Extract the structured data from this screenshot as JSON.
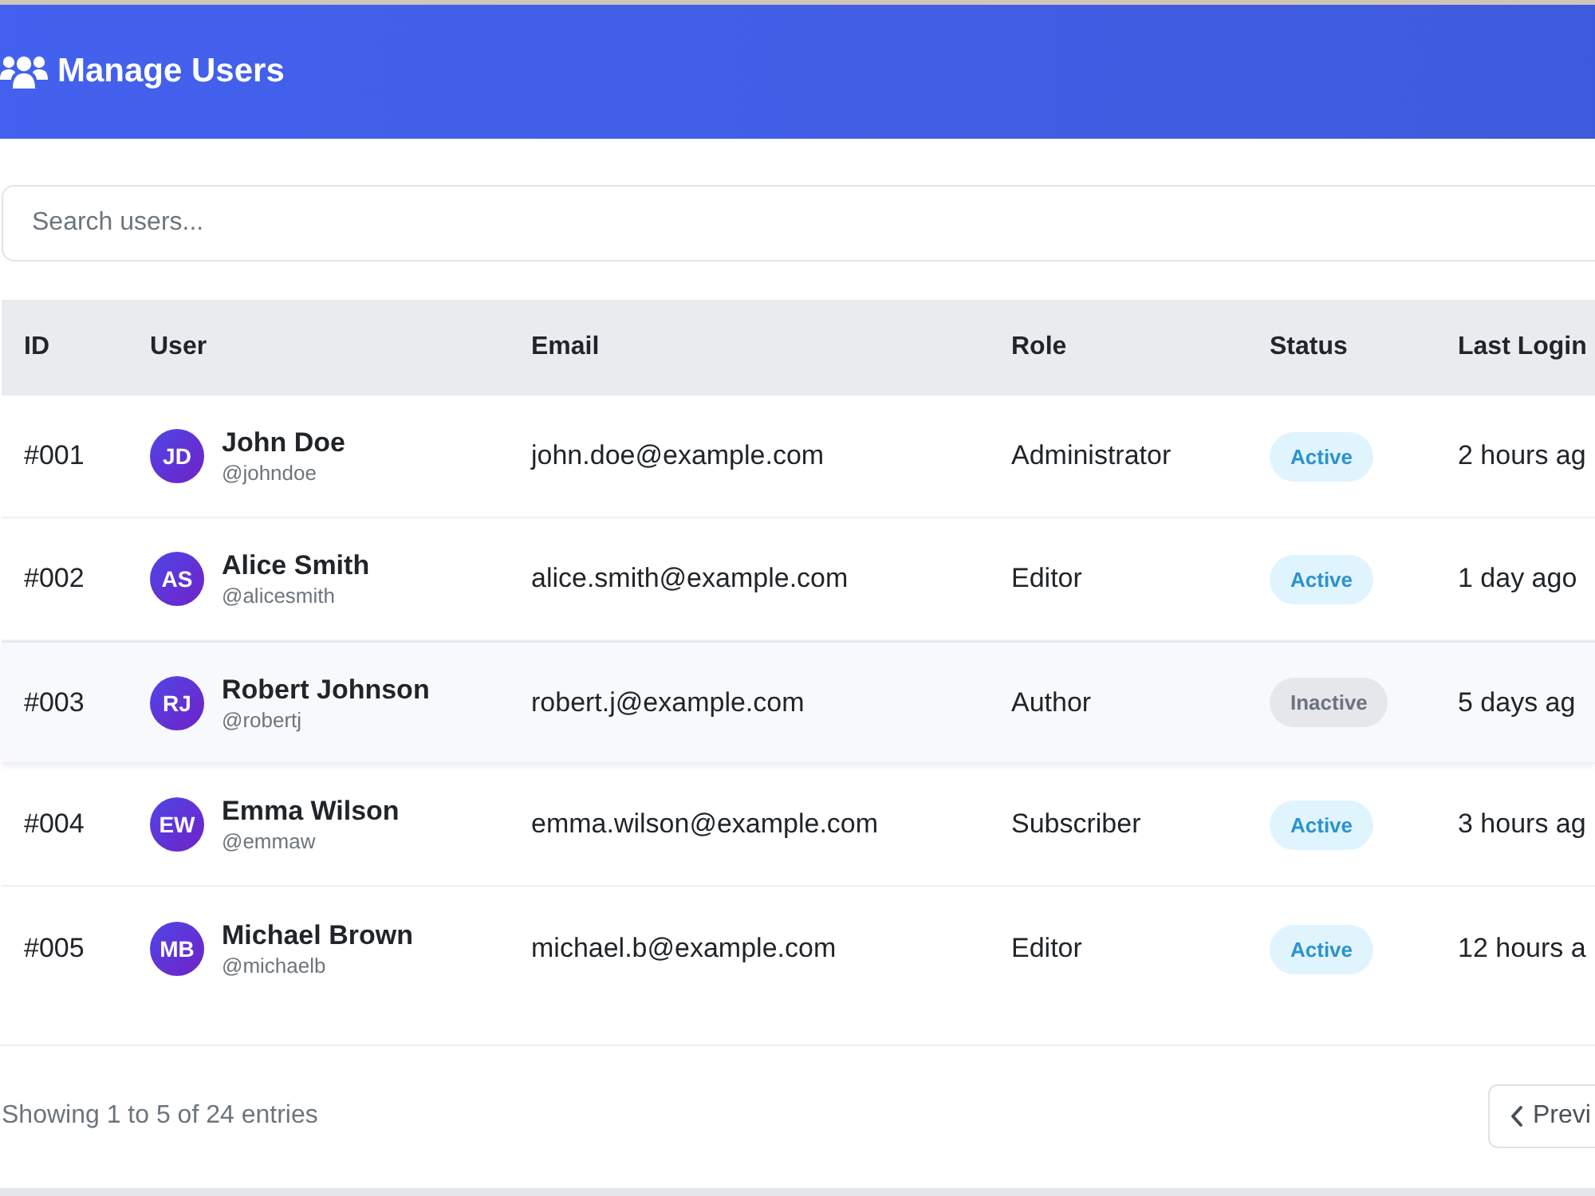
{
  "header": {
    "title": "Manage Users"
  },
  "search": {
    "placeholder": "Search users..."
  },
  "table": {
    "columns": [
      "ID",
      "User",
      "Email",
      "Role",
      "Status",
      "Last Login"
    ],
    "rows": [
      {
        "id": "#001",
        "initials": "JD",
        "name": "John Doe",
        "username": "@johndoe",
        "email": "john.doe@example.com",
        "role": "Administrator",
        "status": {
          "label": "Active",
          "kind": "active"
        },
        "last_login": "2 hours ag",
        "highlighted": false
      },
      {
        "id": "#002",
        "initials": "AS",
        "name": "Alice Smith",
        "username": "@alicesmith",
        "email": "alice.smith@example.com",
        "role": "Editor",
        "status": {
          "label": "Active",
          "kind": "active"
        },
        "last_login": "1 day ago",
        "highlighted": false
      },
      {
        "id": "#003",
        "initials": "RJ",
        "name": "Robert Johnson",
        "username": "@robertj",
        "email": "robert.j@example.com",
        "role": "Author",
        "status": {
          "label": "Inactive",
          "kind": "inactive"
        },
        "last_login": "5 days ag",
        "highlighted": true
      },
      {
        "id": "#004",
        "initials": "EW",
        "name": "Emma Wilson",
        "username": "@emmaw",
        "email": "emma.wilson@example.com",
        "role": "Subscriber",
        "status": {
          "label": "Active",
          "kind": "active"
        },
        "last_login": "3 hours ag",
        "highlighted": false
      },
      {
        "id": "#005",
        "initials": "MB",
        "name": "Michael Brown",
        "username": "@michaelb",
        "email": "michael.b@example.com",
        "role": "Editor",
        "status": {
          "label": "Active",
          "kind": "active"
        },
        "last_login": "12 hours a",
        "highlighted": false
      }
    ]
  },
  "footer": {
    "summary": "Showing 1 to 5 of 24 entries",
    "pagination_button": {
      "label": "Previ"
    }
  }
}
